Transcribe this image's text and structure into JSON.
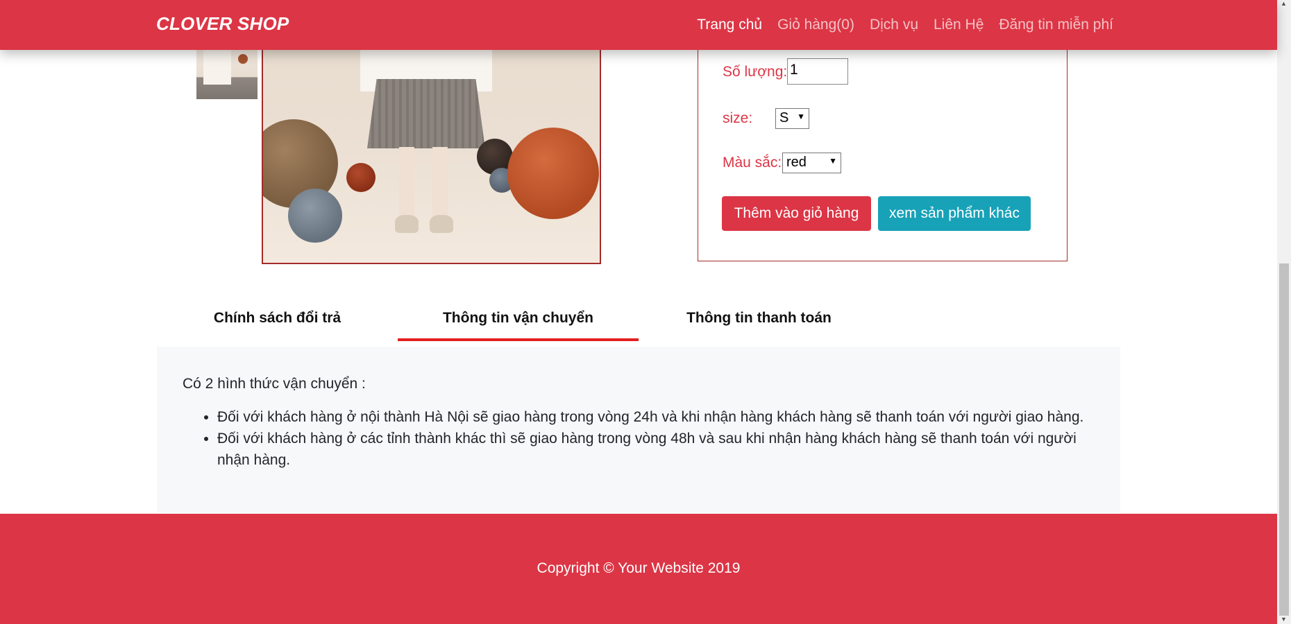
{
  "navbar": {
    "brand": "CLOVER SHOP",
    "links": [
      "Trang chủ",
      "Giỏ hàng(0)",
      "Dịch vụ",
      "Liên Hệ",
      "Đăng tin miễn phí"
    ]
  },
  "product": {
    "quantity_label": "Số lượng:",
    "quantity_value": "1",
    "size_label": "size:",
    "size_selected": "S",
    "color_label": "Màu sắc:",
    "color_selected": "red",
    "add_to_cart": "Thêm vào giỏ hàng",
    "view_other": "xem sản phẩm khác"
  },
  "tabs": [
    {
      "label": "Chính sách đổi trả"
    },
    {
      "label": "Thông tin vận chuyển"
    },
    {
      "label": "Thông tin thanh toán"
    }
  ],
  "shipping": {
    "intro": "Có 2 hình thức vận chuyển :",
    "items": [
      "Đối với khách hàng ở nội thành Hà Nội sẽ giao hàng trong vòng 24h và khi nhận hàng khách hàng sẽ thanh toán với người giao hàng.",
      "Đối với khách hàng ở các tỉnh thành khác thì sẽ giao hàng trong vòng 48h và sau khi nhận hàng khách hàng sẽ thanh toán với người nhận hàng."
    ]
  },
  "footer": {
    "copyright": "Copyright © Your Website 2019"
  },
  "colors": {
    "brand_red": "#dc3545",
    "info_teal": "#17a2b8",
    "tab_underline": "#e41e1e",
    "border_brown": "#a52a2a"
  },
  "icons": {
    "select_caret": "triangle-down-icon"
  }
}
